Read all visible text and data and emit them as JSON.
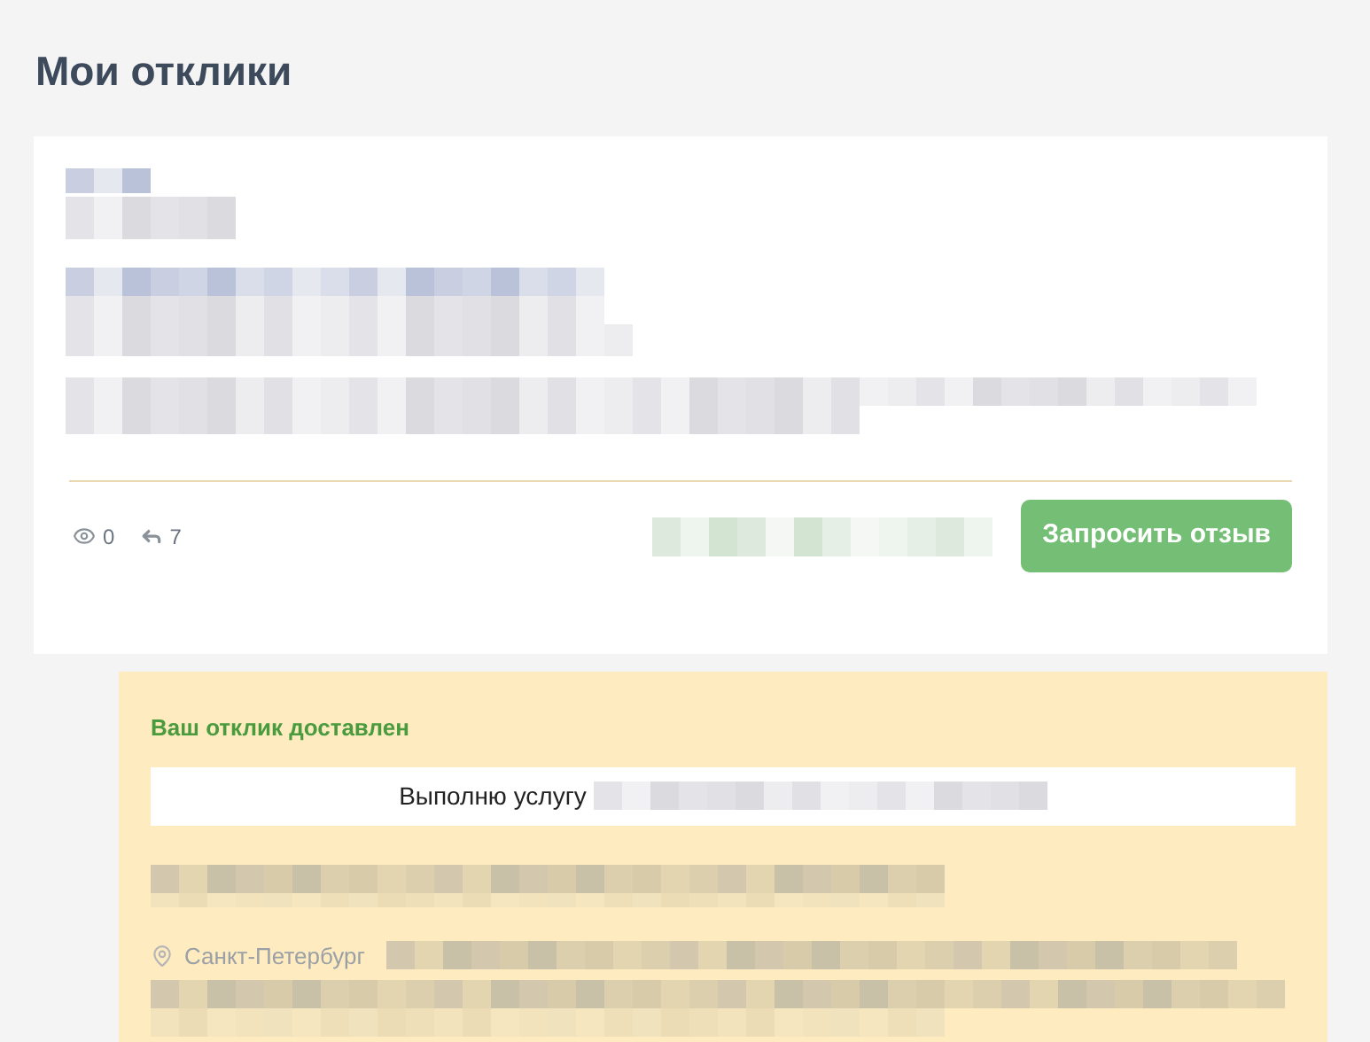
{
  "page_title": "Мои отклики",
  "response_card": {
    "stats": [
      {
        "kind": "views",
        "count": "0"
      },
      {
        "kind": "replies",
        "count": "7"
      }
    ],
    "action_button": "Запросить отзыв"
  },
  "delivered_panel": {
    "status": "Ваш отклик доставлен",
    "message_prefix": "Выполню услугу",
    "city": "Санкт-Петербург"
  }
}
